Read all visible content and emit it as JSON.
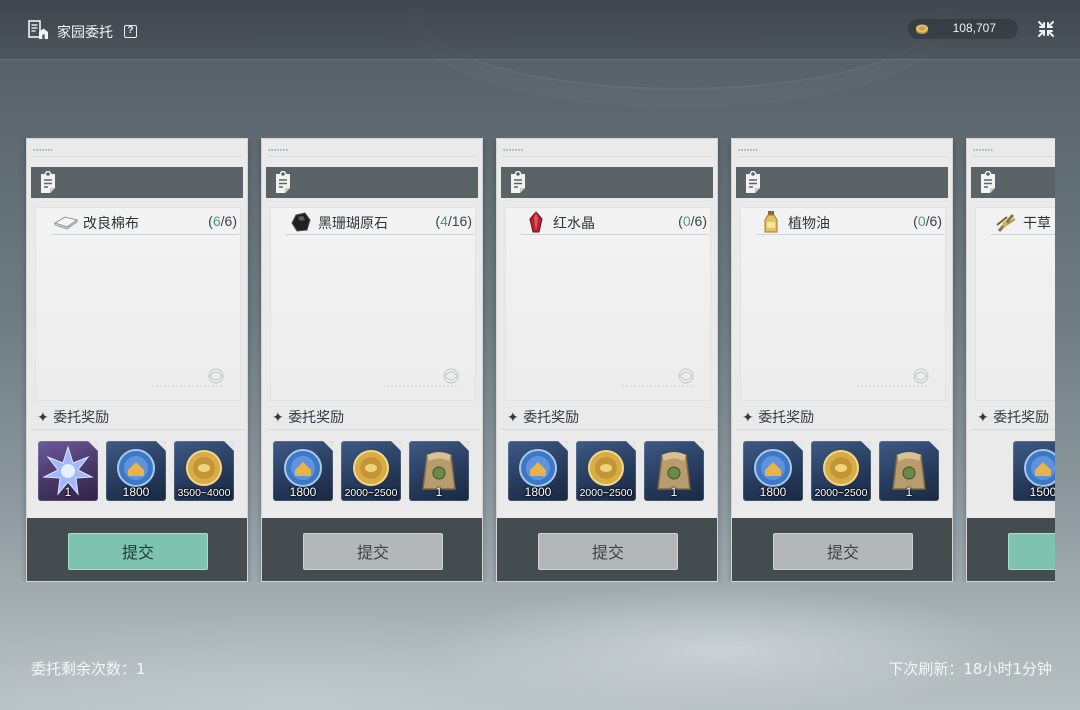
{
  "header": {
    "title": "家园委托",
    "help_symbol": "?",
    "currency_value": "108,707"
  },
  "labels": {
    "rewards_title": "委托奖励",
    "submit": "提交"
  },
  "cards": [
    {
      "item_name": "改良棉布",
      "have": "6",
      "need": "6",
      "submit_state": "active",
      "rewards": [
        {
          "type": "crystal-star",
          "value": "1"
        },
        {
          "type": "blue-token",
          "value": "1800"
        },
        {
          "type": "gold-coin",
          "value": "3500~4000"
        }
      ]
    },
    {
      "item_name": "黑珊瑚原石",
      "have": "4",
      "need": "16",
      "submit_state": "disabled",
      "rewards": [
        {
          "type": "blue-token",
          "value": "1800"
        },
        {
          "type": "gold-coin",
          "value": "2000~2500"
        },
        {
          "type": "seed-bag",
          "value": "1"
        }
      ]
    },
    {
      "item_name": "红水晶",
      "have": "0",
      "need": "6",
      "submit_state": "disabled",
      "rewards": [
        {
          "type": "blue-token",
          "value": "1800"
        },
        {
          "type": "gold-coin",
          "value": "2000~2500"
        },
        {
          "type": "seed-bag",
          "value": "1"
        }
      ]
    },
    {
      "item_name": "植物油",
      "have": "0",
      "need": "6",
      "submit_state": "disabled",
      "rewards": [
        {
          "type": "blue-token",
          "value": "1800"
        },
        {
          "type": "gold-coin",
          "value": "2000~2500"
        },
        {
          "type": "seed-bag",
          "value": "1"
        }
      ]
    },
    {
      "item_name": "干草",
      "submit_state": "active",
      "rewards": [
        {
          "type": "blue-token",
          "value": "1500"
        }
      ]
    }
  ],
  "footer": {
    "remaining_text": "委托剩余次数：1",
    "refresh_text": "下次刷新：18小时1分钟"
  },
  "colors": {
    "have_count": "#4e9c84",
    "submit_active": "#7fc3ae",
    "submit_disabled": "#b3b7b9",
    "card_footer": "#454c50"
  }
}
